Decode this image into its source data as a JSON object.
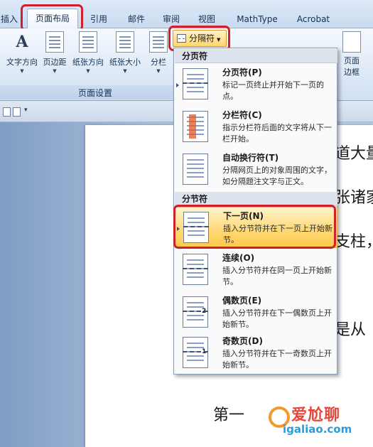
{
  "tabs": [
    {
      "label": "插入"
    },
    {
      "label": "页面布局"
    },
    {
      "label": "引用"
    },
    {
      "label": "邮件"
    },
    {
      "label": "审阅"
    },
    {
      "label": "视图"
    },
    {
      "label": "MathType"
    },
    {
      "label": "Acrobat"
    }
  ],
  "ribbon": {
    "buttons": [
      {
        "label": "文字方向"
      },
      {
        "label": "页边距"
      },
      {
        "label": "纸张方向"
      },
      {
        "label": "纸张大小"
      },
      {
        "label": "分栏"
      }
    ],
    "group_label": "页面设置",
    "breaks_button": "分隔符",
    "page_border_line1": "页面",
    "page_border_line2": "边框"
  },
  "menu": {
    "page_breaks_header": "分页符",
    "section_breaks_header": "分节符",
    "items": [
      {
        "title": "分页符(P)",
        "desc": "标记一页终止并开始下一页的点。"
      },
      {
        "title": "分栏符(C)",
        "desc": "指示分栏符后面的文字将从下一栏开始。"
      },
      {
        "title": "自动换行符(T)",
        "desc": "分隔网页上的对象周围的文字，如分隔题注文字与正文。"
      },
      {
        "title": "下一页(N)",
        "desc": "插入分节符并在下一页上开始新节。"
      },
      {
        "title": "连续(O)",
        "desc": "插入分节符并在同一页上开始新节。"
      },
      {
        "title": "偶数页(E)",
        "desc": "插入分节符并在下一偶数页上开始新节。",
        "icon_num": "2"
      },
      {
        "title": "奇数页(D)",
        "desc": "插入分节符并在下一奇数页上开始新节。",
        "icon_num": "1"
      }
    ]
  },
  "document": {
    "lines": [
      "道大量",
      "张诸家",
      "支柱，",
      "是从",
      "第一"
    ]
  },
  "watermark": {
    "text": "爱尬聊",
    "url": "igaliao.com"
  },
  "colors": {
    "highlight_red": "#d0202a",
    "menu_highlight": "#ffd978"
  }
}
